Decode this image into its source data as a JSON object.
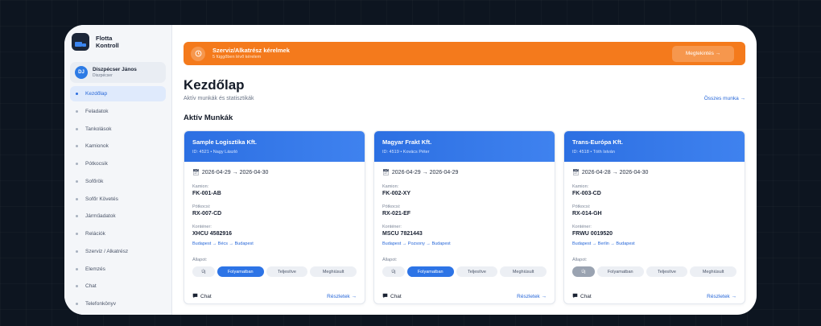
{
  "brand": {
    "name": "Flotta Kontroll"
  },
  "user": {
    "initials": "DJ",
    "name": "Diszpécser János",
    "role": "Diszpécser"
  },
  "sidebar": {
    "items": [
      {
        "label": "Kezdőlap",
        "active": true
      },
      {
        "label": "Feladatok"
      },
      {
        "label": "Tankolások"
      },
      {
        "label": "Kamionok"
      },
      {
        "label": "Pótkocsik"
      },
      {
        "label": "Sofőrök"
      },
      {
        "label": "Sofőr Követés"
      },
      {
        "label": "Járműadatok"
      },
      {
        "label": "Relációk"
      },
      {
        "label": "Szerviz / Alkatrész"
      },
      {
        "label": "Elemzés"
      },
      {
        "label": "Chat"
      },
      {
        "label": "Telefonkönyv"
      }
    ]
  },
  "alert": {
    "icon": "clock-icon",
    "title": "Szerviz/Alkatrész kérelmek",
    "subtitle": "5 függőben lévő kérelem",
    "button": "Megtekintés →",
    "color": "#f47a1c"
  },
  "page": {
    "title": "Kezdőlap",
    "subtitle": "Aktív munkák és statisztikák",
    "all_jobs_link": "Összes munka →",
    "section_title": "Aktív Munkák"
  },
  "card_labels": {
    "truck": "Kamion:",
    "trailer": "Pótkocsi:",
    "container": "Konténer:",
    "status": "Állapot:",
    "chat": "Chat",
    "details": "Részletek →"
  },
  "status_options": [
    "Új",
    "Folyamatban",
    "Teljesítve",
    "Meghiúsult"
  ],
  "jobs": [
    {
      "company": "Sample Logisztika Kft.",
      "id_line": "ID: 4521 • Nagy László",
      "dates": "2026-04-29 → 2026-04-30",
      "truck": "FK-001-AB",
      "trailer": "RX-007-CD",
      "container": "XHCU 4582916",
      "route": "Budapest → Bécs → Budapest",
      "status": "Folyamatban"
    },
    {
      "company": "Magyar Frakt Kft.",
      "id_line": "ID: 4519 • Kovács Péter",
      "dates": "2026-04-29 → 2026-04-29",
      "truck": "FK-002-XY",
      "trailer": "RX-021-EF",
      "container": "MSCU 7821443",
      "route": "Budapest → Pozsony → Budapest",
      "status": "Folyamatban"
    },
    {
      "company": "Trans-Európa Kft.",
      "id_line": "ID: 4518 • Tóth István",
      "dates": "2026-04-28 → 2026-04-30",
      "truck": "FK-003-CD",
      "trailer": "RX-014-GH",
      "container": "FRWU 0019520",
      "route": "Budapest → Berlin → Budapest",
      "status": "Új"
    }
  ],
  "colors": {
    "accent": "#2d6fe0",
    "card_header": "#2c6fe2",
    "alert": "#f47a1c"
  }
}
